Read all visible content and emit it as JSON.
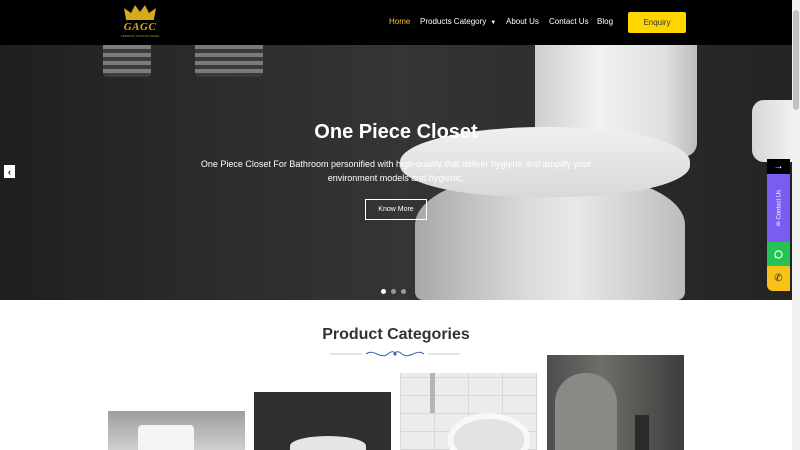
{
  "brand": {
    "logo_text": "GAGC",
    "logo_tagline": "PREMIUM SANITARYWARE"
  },
  "nav": {
    "items": [
      "Home",
      "Products Category",
      "About Us",
      "Contact Us",
      "Blog"
    ],
    "active": "Home",
    "enquiry_label": "Enquiry"
  },
  "hero": {
    "title": "One Piece Closet",
    "description": "One Piece Closet For Bathroom personified with high-quality that deliver hygiene and amplify your environment models and hygienic.",
    "button_label": "Know More",
    "slides": 3,
    "active_slide": 1
  },
  "side_widget": {
    "contact_label": "Contact Us"
  },
  "categories": {
    "title": "Product Categories",
    "cards": 4
  },
  "colors": {
    "accent": "#ffd500",
    "header_bg": "#000000",
    "active_nav": "#f6c32b",
    "contact_purple": "#7a5cf0",
    "whatsapp_green": "#25c255"
  },
  "icons": [
    "crown-logo-icon",
    "chevron-down-icon",
    "chevron-left-icon",
    "arrow-right-icon",
    "envelope-icon",
    "whatsapp-icon",
    "phone-icon"
  ]
}
